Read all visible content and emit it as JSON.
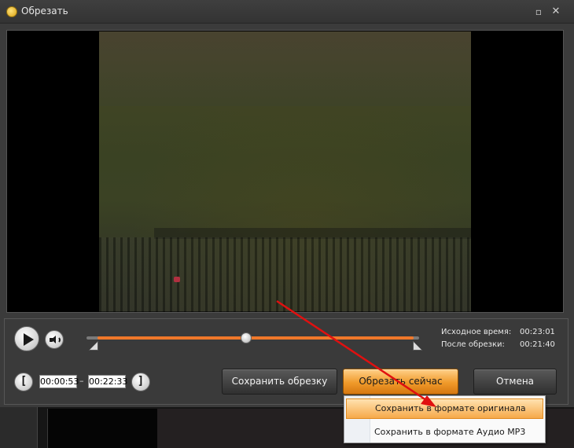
{
  "window": {
    "title": "Обрезать",
    "controls": {
      "restore_icon": "▫",
      "close_icon": "✕"
    }
  },
  "playback": {
    "play_icon": "play-icon",
    "volume_icon": "speaker-icon",
    "position_fraction": 0.48
  },
  "info": {
    "source_label": "Исходное время:",
    "source_value": "00:23:01",
    "after_label": "После обрезки:",
    "after_value": "00:21:40"
  },
  "trim": {
    "start_bracket": "[",
    "end_bracket": "]",
    "start_time": "00:00:53",
    "separator": "–",
    "end_time": "00:22:33"
  },
  "buttons": {
    "save_trim": "Сохранить обрезку",
    "trim_now": "Обрезать сейчас",
    "cancel": "Отмена"
  },
  "dropdown": {
    "items": [
      {
        "label": "Сохранить в формате оригинала",
        "highlighted": true
      },
      {
        "label": "Сохранить в формате Аудио MP3",
        "highlighted": false
      }
    ]
  },
  "colors": {
    "accent": "#f0782a",
    "annotation_arrow": "#e01010"
  }
}
